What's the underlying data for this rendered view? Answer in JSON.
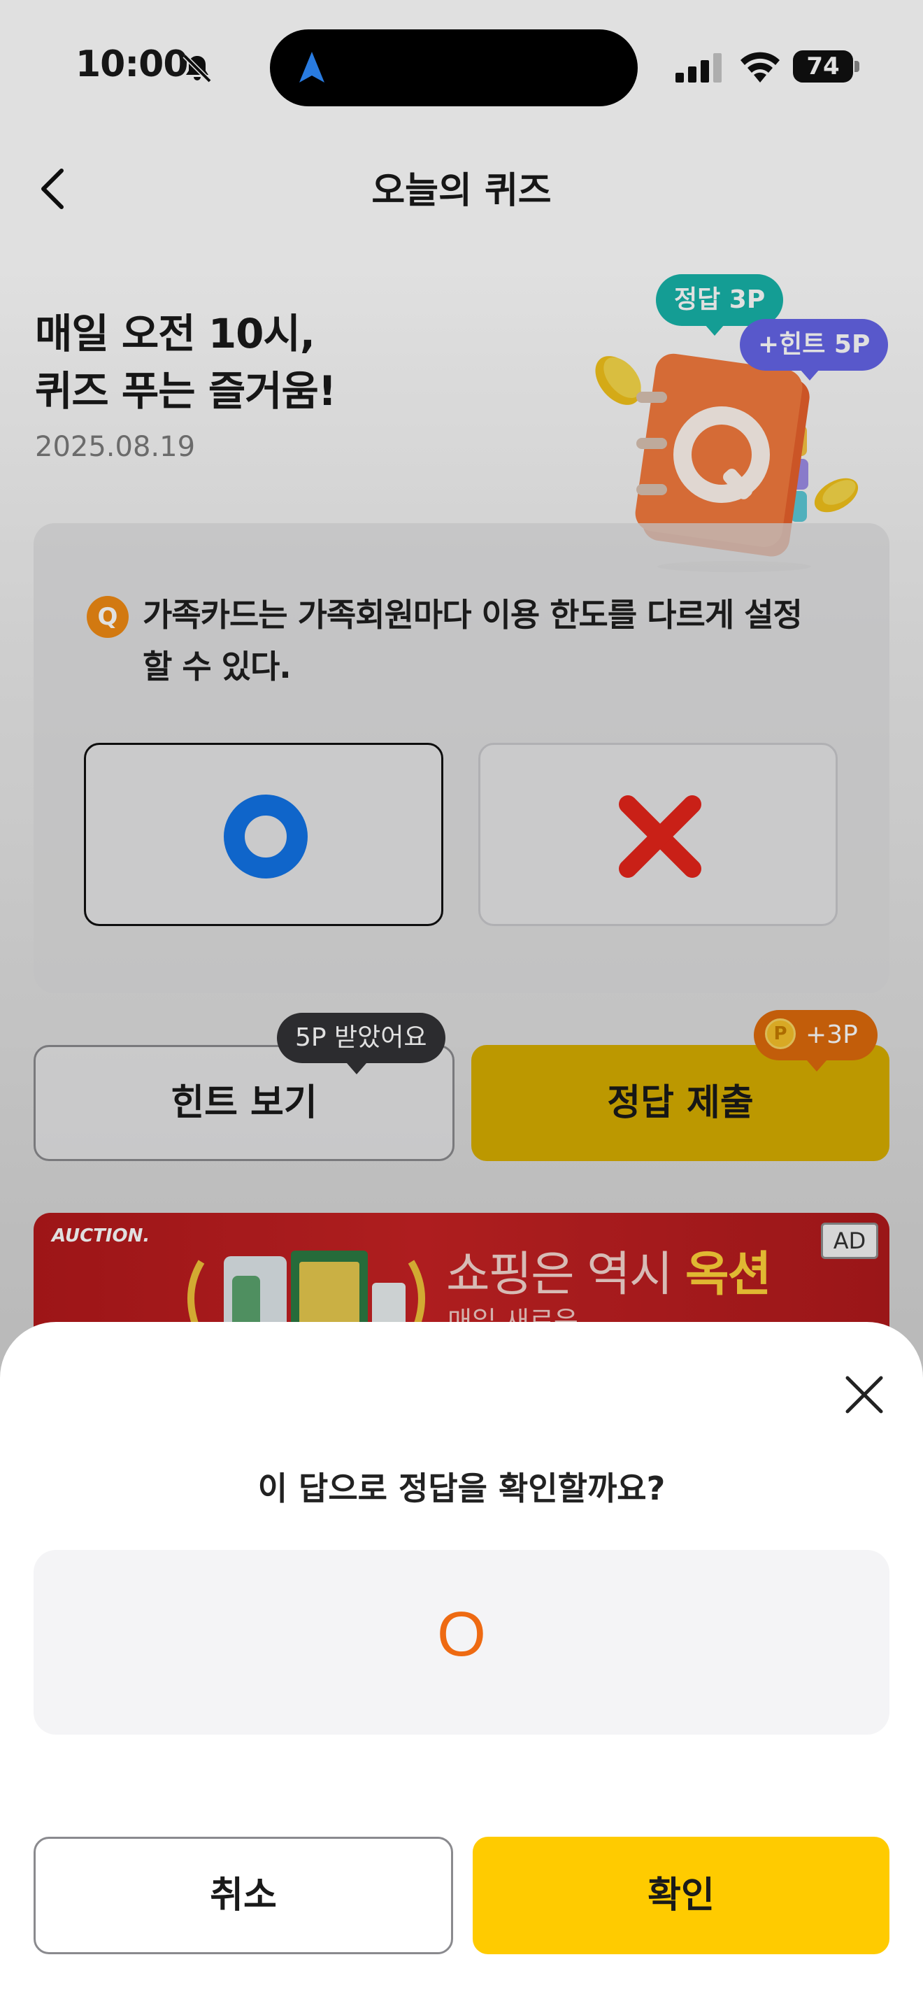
{
  "status_bar": {
    "time": "10:00",
    "battery": "74"
  },
  "header": {
    "title": "오늘의 퀴즈"
  },
  "hero": {
    "line1": "매일 오전 10시,",
    "line2": "퀴즈 푸는 즐거움!",
    "date": "2025.08.19",
    "badge_answer": "정답 3P",
    "badge_hint": "+힌트 5P",
    "illustration_letter": "Q"
  },
  "quiz": {
    "badge": "Q",
    "question": "가족카드는 가족회원마다 이용 한도를 다르게 설정할 수 있다.",
    "options": [
      {
        "id": "O",
        "selected": true,
        "color": "#1274e6"
      },
      {
        "id": "X",
        "selected": false,
        "color": "#e5251b"
      }
    ]
  },
  "actions": {
    "hint_label": "힌트 보기",
    "hint_tooltip": "5P 받았어요",
    "submit_label": "정답 제출",
    "point_coin": "P",
    "point_tooltip": "+3P"
  },
  "ad": {
    "brand": "AUCTION.",
    "headline_prefix": "쇼핑은 역시 ",
    "headline_brand": "옥션",
    "subline": "매일 새로운",
    "badge": "AD"
  },
  "dialog": {
    "title": "이 답으로 정답을 확인할까요?",
    "answer": "O",
    "cancel_label": "취소",
    "confirm_label": "확인"
  },
  "colors": {
    "accent_yellow": "#ffcb00",
    "submit_yellow": "#d7ad00",
    "answer_orange": "#ee6a12",
    "o_blue": "#1274e6",
    "x_red": "#e5251b"
  }
}
